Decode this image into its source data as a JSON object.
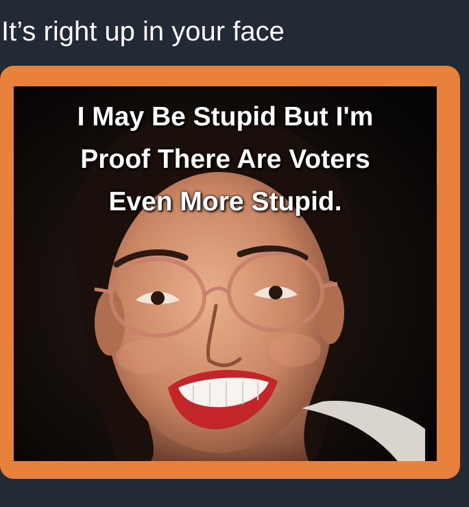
{
  "post": {
    "text": "It’s right up in your face"
  },
  "meme": {
    "caption_lines": [
      "I May Be Stupid But I'm",
      "Proof There Are Voters",
      "Even More Stupid."
    ],
    "frame_color": "#e8813c",
    "background_color": "#222a36"
  }
}
